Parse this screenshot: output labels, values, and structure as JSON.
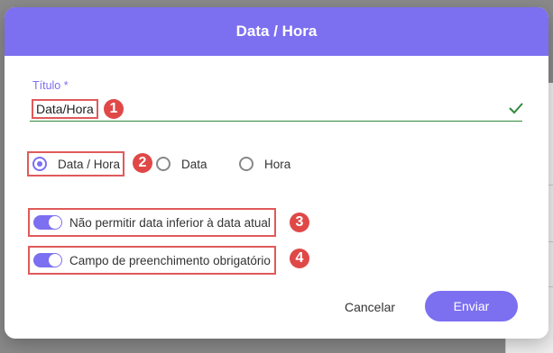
{
  "dialog": {
    "title": "Data / Hora",
    "field": {
      "label": "Título *",
      "value": "Data/Hora"
    },
    "radio_options": [
      {
        "label": "Data / Hora",
        "checked": true
      },
      {
        "label": "Data",
        "checked": false
      },
      {
        "label": "Hora",
        "checked": false
      }
    ],
    "toggles": [
      {
        "label": "Não permitir data inferior à data atual",
        "on": true
      },
      {
        "label": "Campo de preenchimento obrigatório",
        "on": true
      }
    ],
    "buttons": {
      "cancel": "Cancelar",
      "send": "Enviar"
    }
  },
  "annotations": [
    "1",
    "2",
    "3",
    "4"
  ],
  "colors": {
    "accent": "#7c6ff0",
    "annotation": "#e04848",
    "valid": "#2f8a3c"
  }
}
